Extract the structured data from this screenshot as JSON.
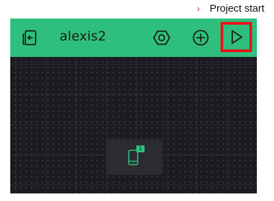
{
  "annotation": {
    "bullet": "›",
    "text": "Project start"
  },
  "toolbar": {
    "project_name": "alexis2",
    "icons": {
      "back": "back-icon",
      "settings": "settings-hexagon-icon",
      "add": "add-circle-icon",
      "play": "play-icon"
    }
  },
  "canvas": {
    "device_tile": {
      "icon": "device-phone-icon",
      "badge_count": "1"
    }
  },
  "colors": {
    "toolbar": "#2fbf7c",
    "canvas": "#1b1c21",
    "highlight": "#e8141c",
    "tile": "#2b2c32"
  }
}
